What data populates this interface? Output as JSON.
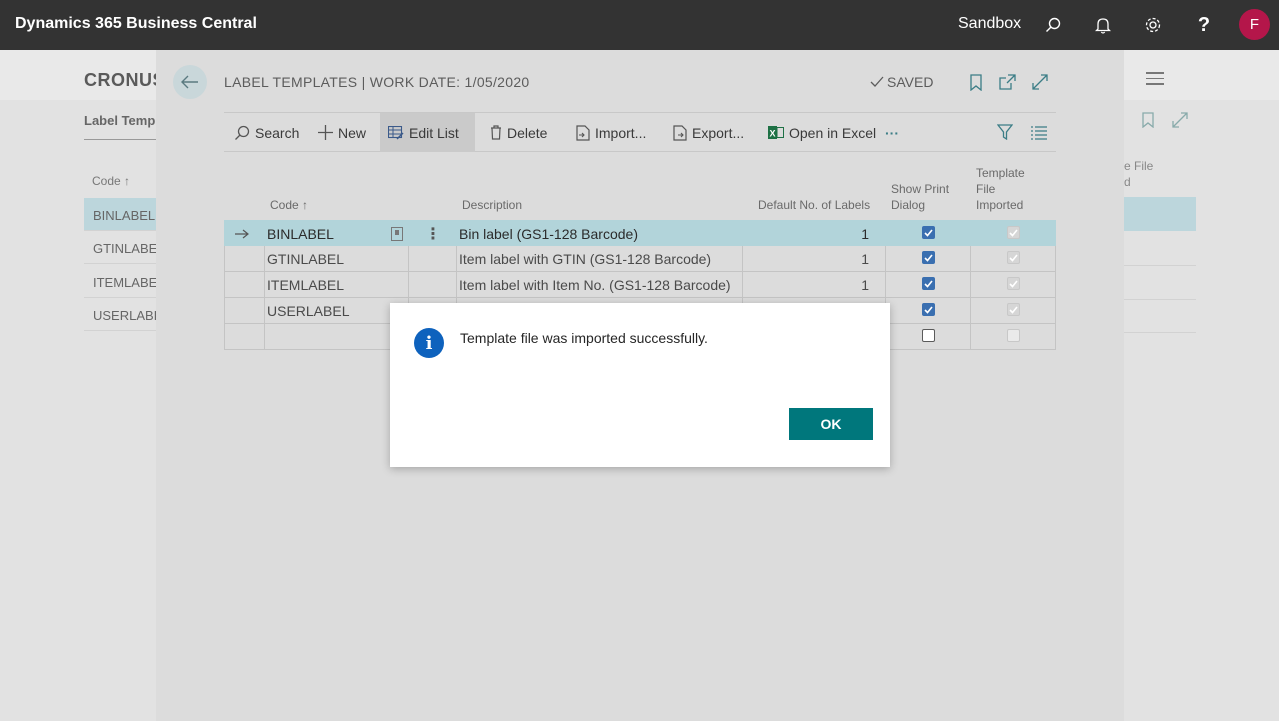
{
  "topbar": {
    "app_title": "Dynamics 365 Business Central",
    "environment": "Sandbox",
    "avatar_initial": "F"
  },
  "background_page": {
    "company": "CRONUS",
    "subtitle": "Label Temp",
    "column_code": "Code ↑",
    "rows": [
      "BINLABEL",
      "GTINLABEL",
      "ITEMLABEL",
      "USERLABE"
    ],
    "right_col_line1": "e File",
    "right_col_line2": "d"
  },
  "page": {
    "title": "LABEL TEMPLATES | WORK DATE: 1/05/2020",
    "saved_label": "SAVED",
    "actions": {
      "search": "Search",
      "new": "New",
      "edit_list": "Edit List",
      "delete": "Delete",
      "import": "Import...",
      "export": "Export...",
      "open_in_excel": "Open in Excel",
      "more": "···"
    },
    "columns": {
      "code": "Code ↑",
      "description": "Description",
      "default_no_labels": "Default No. of Labels",
      "show_print_dialog_1": "Show Print",
      "show_print_dialog_2": "Dialog",
      "template_file_1": "Template",
      "template_file_2": "File",
      "template_file_3": "Imported"
    },
    "rows": [
      {
        "code": "BINLABEL",
        "description": "Bin label (GS1-128 Barcode)",
        "labels": "1",
        "show_print": true,
        "imported": true
      },
      {
        "code": "GTINLABEL",
        "description": "Item label with GTIN (GS1-128 Barcode)",
        "labels": "1",
        "show_print": true,
        "imported": true
      },
      {
        "code": "ITEMLABEL",
        "description": "Item label with Item No. (GS1-128 Barcode)",
        "labels": "1",
        "show_print": true,
        "imported": true
      },
      {
        "code": "USERLABEL",
        "description": "",
        "labels": "",
        "show_print": true,
        "imported": true
      },
      {
        "code": "",
        "description": "",
        "labels": "",
        "show_print": false,
        "imported": false
      }
    ]
  },
  "dialog": {
    "message": "Template file was imported successfully.",
    "ok_label": "OK"
  },
  "colors": {
    "topbar": "#333333",
    "accent": "#00777c",
    "selected_row": "#b2d4da",
    "avatar": "#b4164a",
    "info": "#0e62bd"
  }
}
